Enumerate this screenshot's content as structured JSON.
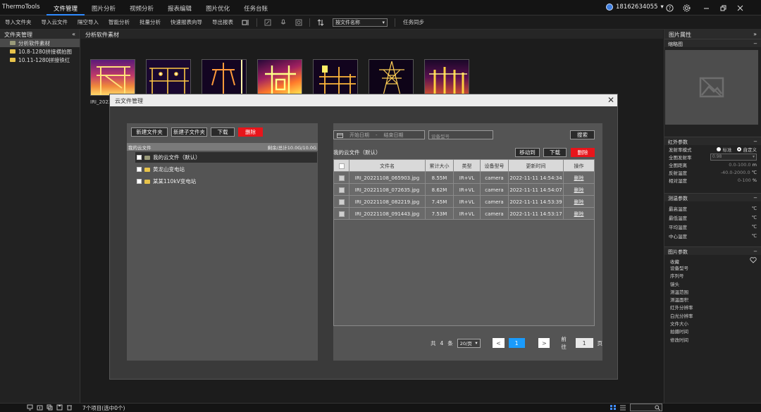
{
  "app": {
    "title": "ThermoTools"
  },
  "menu": {
    "tabs": [
      "文件管理",
      "图片分析",
      "视频分析",
      "报表编辑",
      "图片优化",
      "任务台账"
    ],
    "active": 0
  },
  "user": {
    "phone": "18162634055",
    "caret": "▾"
  },
  "toolbar": {
    "buttons": [
      "导入文件夹",
      "导入云文件",
      "隔空导入",
      "智能分析",
      "批量分析",
      "快速报表向导",
      "导出报表"
    ],
    "sort_value": "按文件名称",
    "task_sync": "任务同步"
  },
  "left_panel": {
    "title": "文件夹管理",
    "collapse": "«",
    "folders": [
      "分析软件素材",
      "10.8-1280拼接横拍图",
      "10.11-1280拼接铁红"
    ]
  },
  "content": {
    "title": "分析软件素材",
    "first_label": "IRI_2022"
  },
  "status": {
    "text": "7个项目(选中0个)"
  },
  "right_panel": {
    "title": "图片属性",
    "expand": "»",
    "thumbnail_title": "缩略图",
    "ir_title": "红外参数",
    "emissivity_mode": "发射率模式",
    "mode_standard": "标准",
    "mode_custom": "自定义",
    "ir_rows": [
      {
        "label": "全图发射率",
        "value": "0.98",
        "unit": ""
      },
      {
        "label": "全图距离",
        "value": "0.0-100.0",
        "unit": "m"
      },
      {
        "label": "反射温度",
        "value": "-40.0-2000.0",
        "unit": "℃"
      },
      {
        "label": "相对湿度",
        "value": "0-100",
        "unit": "%"
      }
    ],
    "temp_title": "测温参数",
    "temp_rows": [
      {
        "label": "最高温度",
        "unit": "℃"
      },
      {
        "label": "最低温度",
        "unit": "℃"
      },
      {
        "label": "平均温度",
        "unit": "℃"
      },
      {
        "label": "中心温度",
        "unit": "℃"
      }
    ],
    "pic_title": "图片参数",
    "favorite": "收藏",
    "pic_rows": [
      "设备型号",
      "序列号",
      "镜头",
      "测温范围",
      "测温面积",
      "红外分辨率",
      "白光分辨率",
      "文件大小",
      "拍摄时间",
      "修改时间"
    ]
  },
  "modal": {
    "title": "云文件管理",
    "close": "✕",
    "left_buttons": {
      "new_folder": "新建文件夹",
      "new_subfolder": "新建子文件夹",
      "download": "下载",
      "delete": "删除"
    },
    "tree_header": "我的云文件",
    "tree_usage": "剩余/总计10.0G/10.0G",
    "tree_nodes": [
      "我的云文件（默认）",
      "黄龙山变电站",
      "某某110kV变电站"
    ],
    "date_start": "开始日期",
    "date_sep": "-",
    "date_end": "结束日期",
    "device_placeholder": "设备型号",
    "search": "搜索",
    "file_title": "我的云文件（默认）",
    "move_to": "移动到",
    "download": "下载",
    "delete": "删除",
    "columns": [
      "文件名",
      "累计大小",
      "类型",
      "设备型号",
      "更新时间",
      "操作"
    ],
    "rows": [
      {
        "name": "IRI_20221108_065903.jpg",
        "size": "8.55M",
        "type": "IR+VL",
        "device": "camera",
        "time": "2022-11-11 14:54:34",
        "op": "删除"
      },
      {
        "name": "IRI_20221108_072635.jpg",
        "size": "8.62M",
        "type": "IR+VL",
        "device": "camera",
        "time": "2022-11-11 14:54:07",
        "op": "删除"
      },
      {
        "name": "IRI_20221108_082219.jpg",
        "size": "7.45M",
        "type": "IR+VL",
        "device": "camera",
        "time": "2022-11-11 14:53:39",
        "op": "删除"
      },
      {
        "name": "IRI_20221108_091443.jpg",
        "size": "7.53M",
        "type": "IR+VL",
        "device": "camera",
        "time": "2022-11-11 14:53:17",
        "op": "删除"
      }
    ],
    "pager": {
      "total_prefix": "共",
      "total": "4",
      "total_suffix": "条",
      "page_size": "20/页",
      "prev": "<",
      "page": "1",
      "next": ">",
      "goto": "前往",
      "goto_value": "1",
      "page_unit": "页"
    }
  }
}
